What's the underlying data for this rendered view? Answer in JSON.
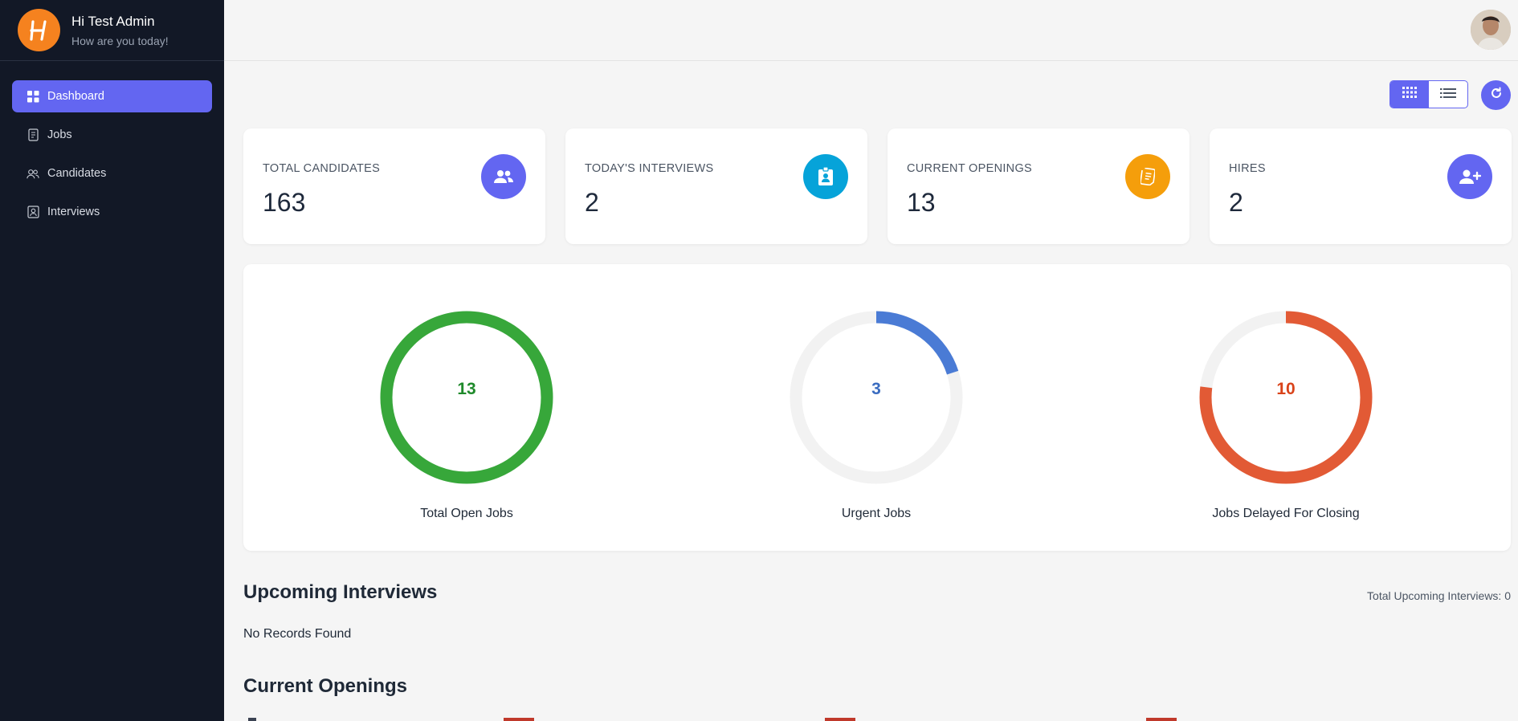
{
  "app": {
    "greeting_title": "Hi Test Admin",
    "greeting_sub": "How are you today!",
    "logo_icon": "brand-logo-h",
    "accent": "#6366f1"
  },
  "sidebar": {
    "items": [
      {
        "label": "Dashboard",
        "icon": "dashboard-icon",
        "active": true
      },
      {
        "label": "Jobs",
        "icon": "document-icon",
        "active": false
      },
      {
        "label": "Candidates",
        "icon": "users-icon",
        "active": false
      },
      {
        "label": "Interviews",
        "icon": "id-badge-icon",
        "active": false
      }
    ]
  },
  "toolbar": {
    "grid_view_icon": "grid-icon",
    "list_view_icon": "list-icon",
    "refresh_icon": "refresh-icon"
  },
  "stats": [
    {
      "label": "TOTAL CANDIDATES",
      "value": "163",
      "icon": "users-icon",
      "color": "#6366f1"
    },
    {
      "label": "TODAY'S INTERVIEWS",
      "value": "2",
      "icon": "id-badge-icon",
      "color": "#06a3d9"
    },
    {
      "label": "CURRENT OPENINGS",
      "value": "13",
      "icon": "document-icon",
      "color": "#f59e0b"
    },
    {
      "label": "HIRES",
      "value": "2",
      "icon": "user-plus-icon",
      "color": "#6366f1"
    }
  ],
  "donuts": [
    {
      "label": "Total Open Jobs",
      "value": "13",
      "fraction": 1.0,
      "color": "#37a73a",
      "text_color": "#1f8a2b"
    },
    {
      "label": "Urgent Jobs",
      "value": "3",
      "fraction": 0.2,
      "color": "#4a7bd5",
      "text_color": "#3a6cc0"
    },
    {
      "label": "Jobs Delayed For Closing",
      "value": "10",
      "fraction": 0.77,
      "color": "#e25a35",
      "text_color": "#d9431a"
    }
  ],
  "upcoming": {
    "title": "Upcoming Interviews",
    "total_text": "Total Upcoming Interviews: 0",
    "empty_text": "No Records Found"
  },
  "openings": {
    "title": "Current Openings"
  }
}
